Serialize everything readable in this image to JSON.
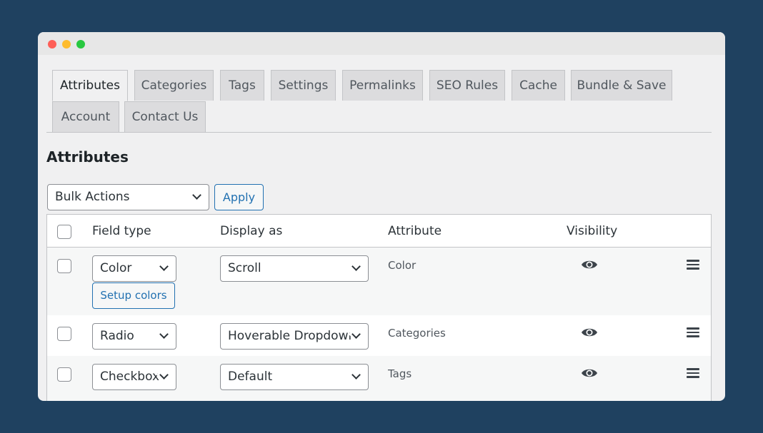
{
  "tabs": [
    {
      "label": "Attributes",
      "active": true
    },
    {
      "label": "Categories",
      "active": false
    },
    {
      "label": "Tags",
      "active": false
    },
    {
      "label": "Settings",
      "active": false
    },
    {
      "label": "Permalinks",
      "active": false
    },
    {
      "label": "SEO Rules",
      "active": false
    },
    {
      "label": "Cache",
      "active": false
    },
    {
      "label": "Bundle & Save",
      "active": false
    },
    {
      "label": "Account",
      "active": false
    },
    {
      "label": "Contact Us",
      "active": false
    }
  ],
  "page_title": "Attributes",
  "bulk_actions": {
    "selected": "Bulk Actions",
    "apply_label": "Apply"
  },
  "table": {
    "headers": {
      "field_type": "Field type",
      "display_as": "Display as",
      "attribute": "Attribute",
      "visibility": "Visibility"
    },
    "rows": [
      {
        "field_type": "Color",
        "display_as": "Scroll",
        "attribute": "Color",
        "setup_label": "Setup colors",
        "visible": true,
        "visibility_icon": "eye-icon"
      },
      {
        "field_type": "Radio",
        "display_as": "Hoverable Dropdown",
        "attribute": "Categories",
        "visible": true,
        "visibility_icon": "eye-icon"
      },
      {
        "field_type": "Checkbox",
        "display_as": "Default",
        "attribute": "Tags",
        "visible": true,
        "visibility_icon": "eye-icon"
      }
    ]
  },
  "colors": {
    "background": "#1f4160",
    "accent": "#2271b1"
  }
}
